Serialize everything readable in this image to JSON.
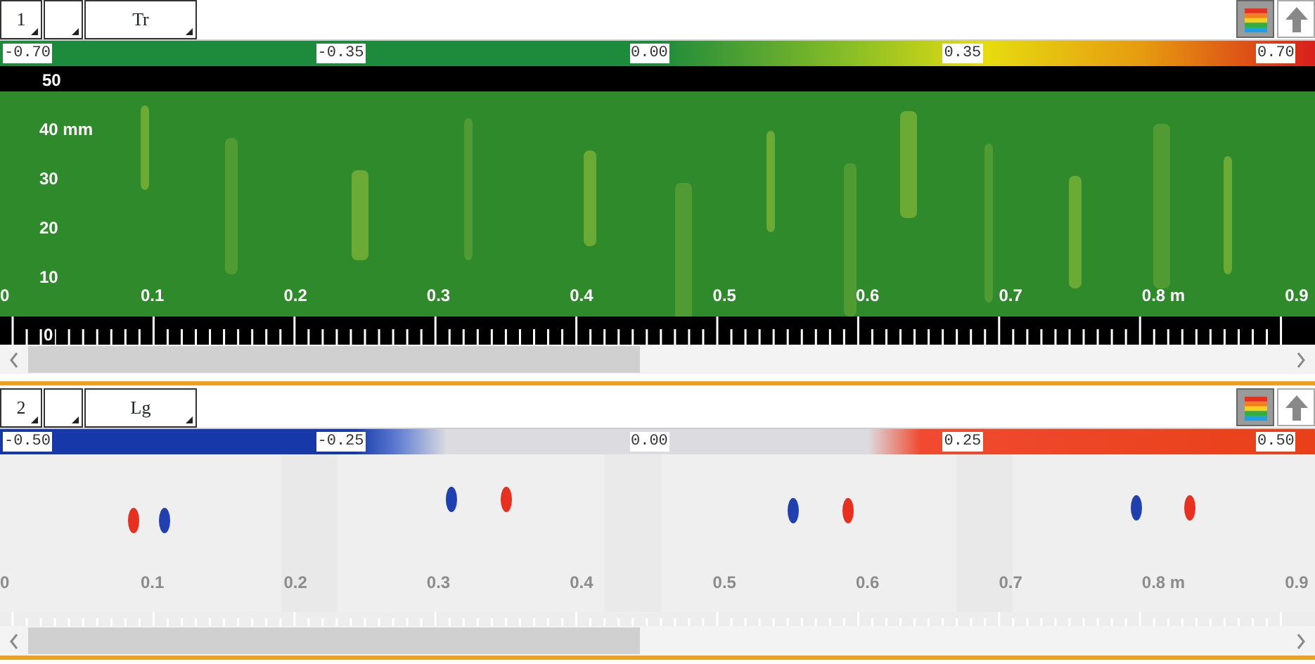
{
  "panels": [
    {
      "kind": "green-map",
      "selectors": [
        {
          "kind": "number",
          "value": "1"
        },
        {
          "kind": "empty"
        },
        {
          "kind": "name",
          "value": "Tr"
        }
      ],
      "tools": [
        {
          "kind": "palette",
          "selected": true
        },
        {
          "kind": "up",
          "selected": false
        }
      ],
      "scale_labels": [
        "-0.70",
        "-0.35",
        "0.00",
        "0.35",
        "0.70"
      ],
      "y_labels": [
        "50",
        "40 mm",
        "30",
        "20",
        "10"
      ],
      "x_labels": [
        "0",
        "0.1",
        "0.2",
        "0.3",
        "0.4",
        "0.5",
        "0.6",
        "0.7",
        "0.8 m",
        "0.9"
      ],
      "ruler_label": "0"
    },
    {
      "kind": "diverging-map",
      "selectors": [
        {
          "kind": "number",
          "value": "2"
        },
        {
          "kind": "empty"
        },
        {
          "kind": "name",
          "value": "Lg"
        }
      ],
      "tools": [
        {
          "kind": "palette",
          "selected": true
        },
        {
          "kind": "up",
          "selected": false
        }
      ],
      "scale_labels": [
        "-0.50",
        "-0.25",
        "0.00",
        "0.25",
        "0.50"
      ],
      "x_labels": [
        "0",
        "0.1",
        "0.2",
        "0.3",
        "0.4",
        "0.5",
        "0.6",
        "0.7",
        "0.8 m",
        "0.9"
      ]
    }
  ]
}
